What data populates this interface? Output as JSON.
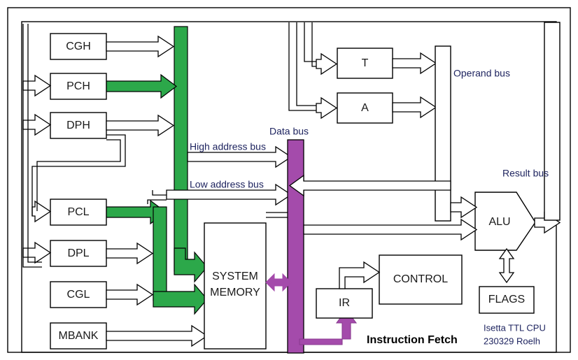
{
  "diagram": {
    "title_caption": "Instruction Fetch",
    "credit_line_1": "Isetta TTL CPU",
    "credit_line_2": "230329 Roelh",
    "colors": {
      "address_path": "#2CA84A",
      "data_path": "#A44BAB",
      "outline": "#000000",
      "label_text": "#1f2560",
      "block_fill": "#ffffff"
    }
  },
  "blocks": {
    "cgh": "CGH",
    "pch": "PCH",
    "dph": "DPH",
    "pcl": "PCL",
    "dpl": "DPL",
    "cgl": "CGL",
    "mbank": "MBANK",
    "system_memory_line1": "SYSTEM",
    "system_memory_line2": "MEMORY",
    "t": "T",
    "a": "A",
    "alu": "ALU",
    "flags": "FLAGS",
    "control": "CONTROL",
    "ir": "IR"
  },
  "buses": {
    "high_address": "High address bus",
    "low_address": "Low address bus",
    "data": "Data bus",
    "operand": "Operand bus",
    "result": "Result bus"
  }
}
